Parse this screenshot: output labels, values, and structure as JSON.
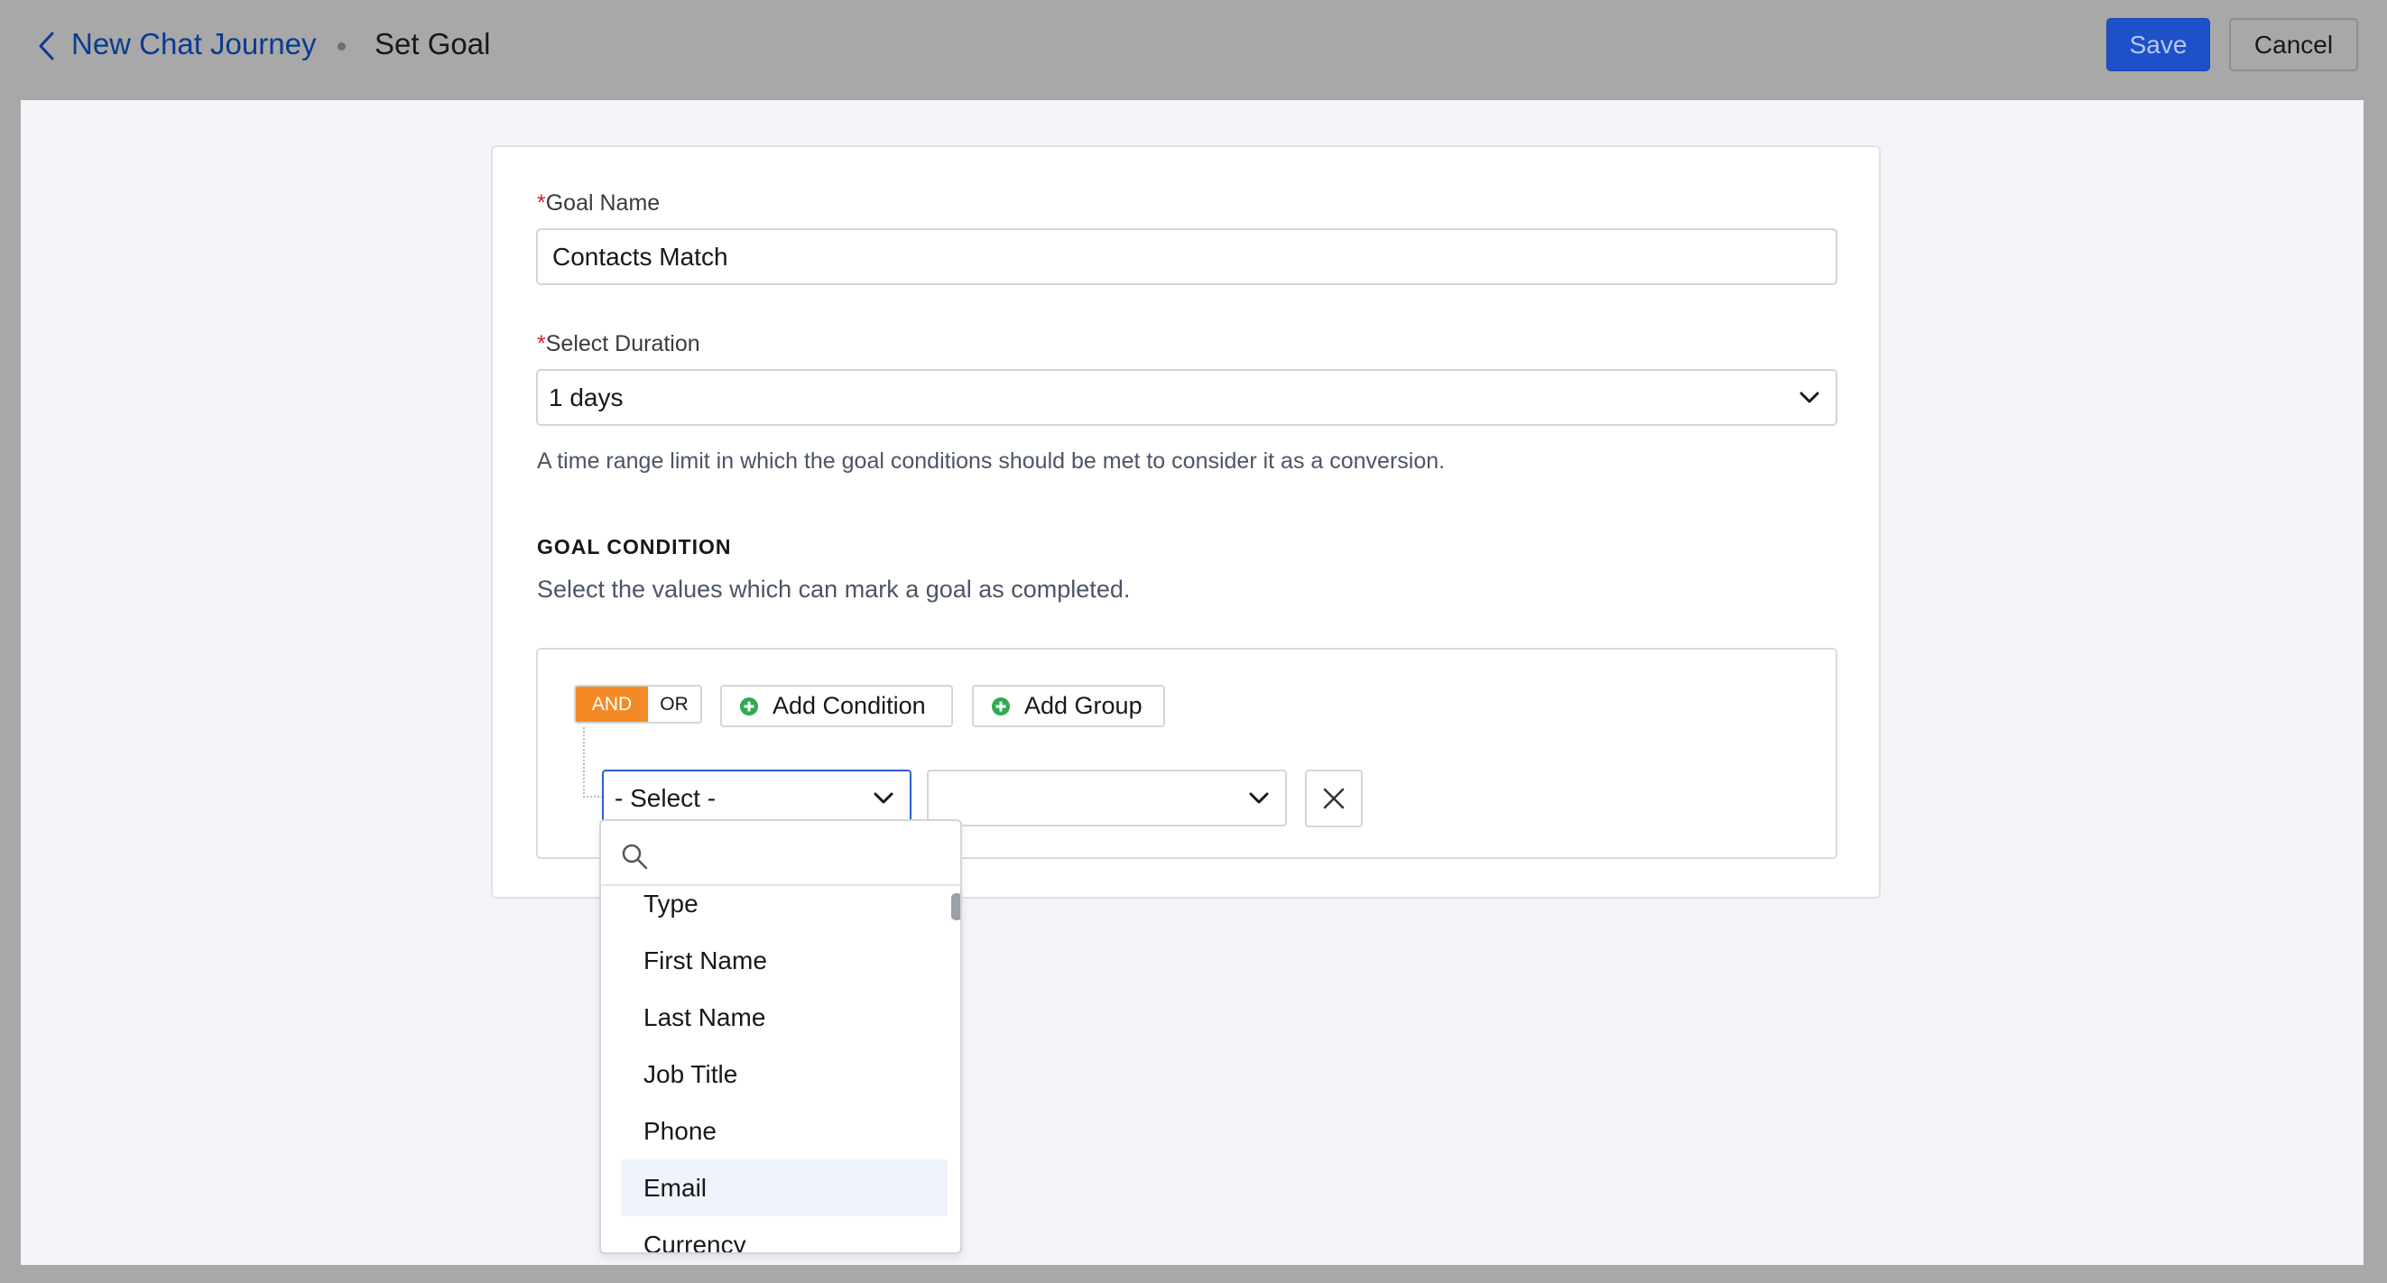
{
  "header": {
    "breadcrumb_parent": "New Chat Journey",
    "breadcrumb_current": "Set Goal",
    "save_label": "Save",
    "cancel_label": "Cancel"
  },
  "form": {
    "goal_name_label": "Goal Name",
    "goal_name_value": "Contacts Match",
    "duration_label": "Select Duration",
    "duration_value": "1 days",
    "duration_hint": "A time range limit in which the goal conditions should be met to consider it as a conversion.",
    "required_marker": "*"
  },
  "goal_condition": {
    "title": "GOAL CONDITION",
    "subtitle": "Select the values which can mark a goal as completed.",
    "and_label": "AND",
    "or_label": "OR",
    "add_condition_label": "Add Condition",
    "add_group_label": "Add Group",
    "field_select_value": "- Select -",
    "operator_select_value": ""
  },
  "dropdown": {
    "search_placeholder": "",
    "items": [
      "Type",
      "First Name",
      "Last Name",
      "Job Title",
      "Phone",
      "Email",
      "Currency"
    ],
    "highlighted_item": "Email"
  },
  "colors": {
    "primary": "#1d50c9",
    "accent_and": "#f38a26",
    "add_icon": "#2fab4f",
    "required": "#d1203b",
    "link": "#0b3b8f"
  },
  "icons": [
    "chevron-left-icon",
    "chevron-down-icon",
    "plus-circle-icon",
    "close-icon",
    "search-icon"
  ]
}
